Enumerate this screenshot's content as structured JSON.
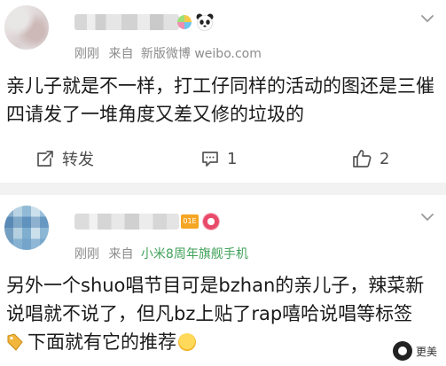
{
  "posts": [
    {
      "meta": {
        "time": "刚刚",
        "from_label": "来自",
        "source": "新版微博 weibo.com"
      },
      "content": "亲儿子就是不一样，打工仔同样的活动的图还是三催四请发了一堆角度又差又修的垃圾的",
      "actions": {
        "repost_label": "转发",
        "comment_count": "1",
        "like_count": "2"
      }
    },
    {
      "meta": {
        "time": "刚刚",
        "from_label": "来自",
        "source": "小米8周年旗舰手机"
      },
      "content_line1": "另外一个shuo唱节目可是bzhan的亲儿子，辣菜新",
      "content_line2": "说唱就不说了，但凡bz上贴了rap嘻哈说唱等标签",
      "content_line3": "下面就有它的推荐",
      "movie_badge_text": "01E"
    }
  ],
  "watermark": {
    "text": "更美"
  },
  "icons": {
    "chevron": "chevron-down-icon",
    "repost": "repost-icon",
    "comment": "comment-icon",
    "like": "thumb-up-icon"
  },
  "colors": {
    "source_green": "#41a25a",
    "meta_gray": "#8c8c8c",
    "divider": "#f2f2f2"
  }
}
